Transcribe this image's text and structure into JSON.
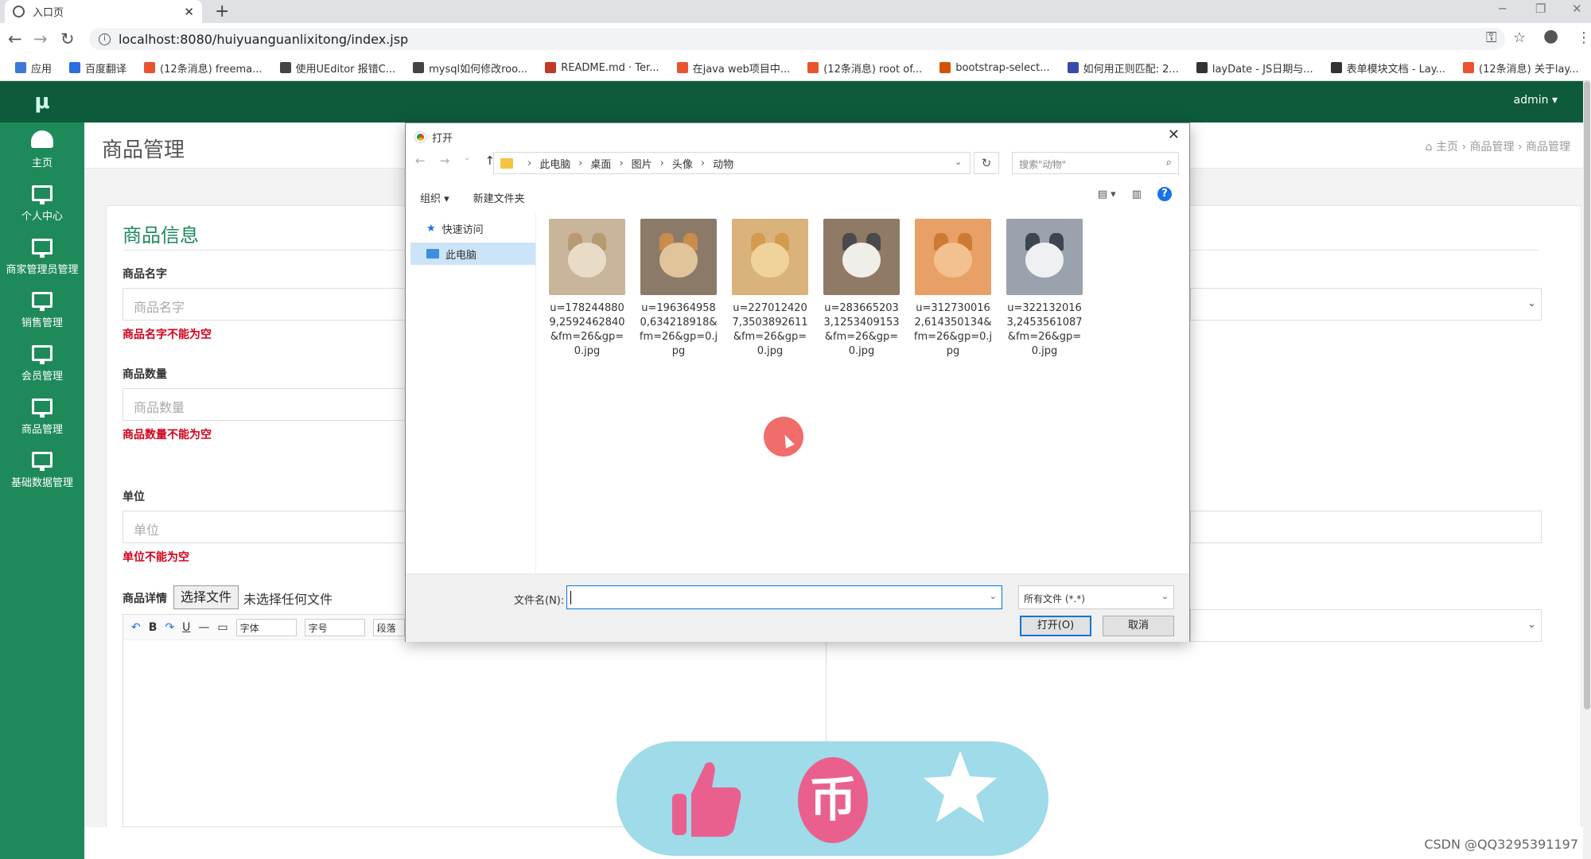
{
  "browser": {
    "tab_title": "入口页",
    "tab_close": "✕",
    "new_tab": "+",
    "url": "localhost:8080/huiyuanguanlixitong/index.jsp",
    "bookmarks": [
      {
        "label": "应用",
        "color": "#3c78d8"
      },
      {
        "label": "百度翻译",
        "color": "#2a6fdb"
      },
      {
        "label": "(12条消息) freema...",
        "color": "#e8542f"
      },
      {
        "label": "使用UEditor 报错C...",
        "color": "#444444"
      },
      {
        "label": "mysql如何修改roo...",
        "color": "#444444"
      },
      {
        "label": "README.md · Ter...",
        "color": "#c0392b"
      },
      {
        "label": "在java web项目中...",
        "color": "#e8542f"
      },
      {
        "label": "(12条消息) root of...",
        "color": "#e8542f"
      },
      {
        "label": "bootstrap-select...",
        "color": "#d35400"
      },
      {
        "label": "如何用正则匹配: 2...",
        "color": "#3949ab"
      },
      {
        "label": "layDate - JS日期与...",
        "color": "#333333"
      },
      {
        "label": "表单模块文档 - Lay...",
        "color": "#333333"
      },
      {
        "label": "(12条消息) 关于lay...",
        "color": "#e8542f"
      }
    ]
  },
  "app": {
    "logo": "μ",
    "admin": "admin ▾",
    "sidebar": [
      {
        "label": "主页",
        "icon": "dashboard-icon"
      },
      {
        "label": "个人中心",
        "icon": "monitor-icon"
      },
      {
        "label": "商家管理员管理",
        "icon": "monitor-icon"
      },
      {
        "label": "销售管理",
        "icon": "monitor-icon"
      },
      {
        "label": "会员管理",
        "icon": "monitor-icon"
      },
      {
        "label": "商品管理",
        "icon": "monitor-icon"
      },
      {
        "label": "基础数据管理",
        "icon": "monitor-icon"
      }
    ],
    "page_title": "商品管理",
    "breadcrumb": "主页   ›   商品管理   ›   商品管理",
    "breadcrumb_home_icon": "home-icon",
    "form": {
      "title": "商品信息",
      "name_label": "商品名字",
      "name_placeholder": "商品名字",
      "name_error": "商品名字不能为空",
      "qty_label": "商品数量",
      "qty_placeholder": "商品数量",
      "qty_error": "商品数量不能为空",
      "unit_label": "单位",
      "unit_placeholder": "单位",
      "unit_error": "单位不能为空",
      "detail_label": "商品详情",
      "file_button": "选择文件",
      "file_status": "未选择任何文件",
      "font_select": "字体",
      "size_select": "字号",
      "para_select": "段落"
    }
  },
  "dialog": {
    "title": "打开",
    "path": [
      "此电脑",
      "桌面",
      "图片",
      "头像",
      "动物"
    ],
    "search_placeholder": "搜索\"动物\"",
    "organize": "组织 ▾",
    "new_folder": "新建文件夹",
    "nav": [
      {
        "label": "快速访问",
        "selected": false
      },
      {
        "label": "此电脑",
        "selected": true
      }
    ],
    "files": [
      {
        "name": "u=1782448809,2592462840&fm=26&gp=0.jpg",
        "bg": "#c8b59a",
        "face": "#e9dcc7",
        "ear": "#b89a72"
      },
      {
        "name": "u=1963649580,634218918&fm=26&gp=0.jpg",
        "bg": "#8c7a68",
        "face": "#e2c49b",
        "ear": "#c98c4d"
      },
      {
        "name": "u=2270124207,3503892611&fm=26&gp=0.jpg",
        "bg": "#d9b37b",
        "face": "#f0d39b",
        "ear": "#d49a4d"
      },
      {
        "name": "u=2836652033,1253409153&fm=26&gp=0.jpg",
        "bg": "#8f7a66",
        "face": "#f0eee9",
        "ear": "#4a4a4a"
      },
      {
        "name": "u=3127300162,614350134&fm=26&gp=0.jpg",
        "bg": "#e8a067",
        "face": "#f3c08f",
        "ear": "#cd7a35"
      },
      {
        "name": "u=3221320163,2453561087&fm=26&gp=0.jpg",
        "bg": "#9aa3ad",
        "face": "#eef0f2",
        "ear": "#3d4650"
      }
    ],
    "filename_label": "文件名(N):",
    "filename_value": "",
    "filter": "所有文件 (*.*)",
    "open_button": "打开(O)",
    "cancel_button": "取消"
  },
  "overlay": {
    "coin_glyph": "币"
  },
  "watermark": "CSDN @QQ3295391197"
}
